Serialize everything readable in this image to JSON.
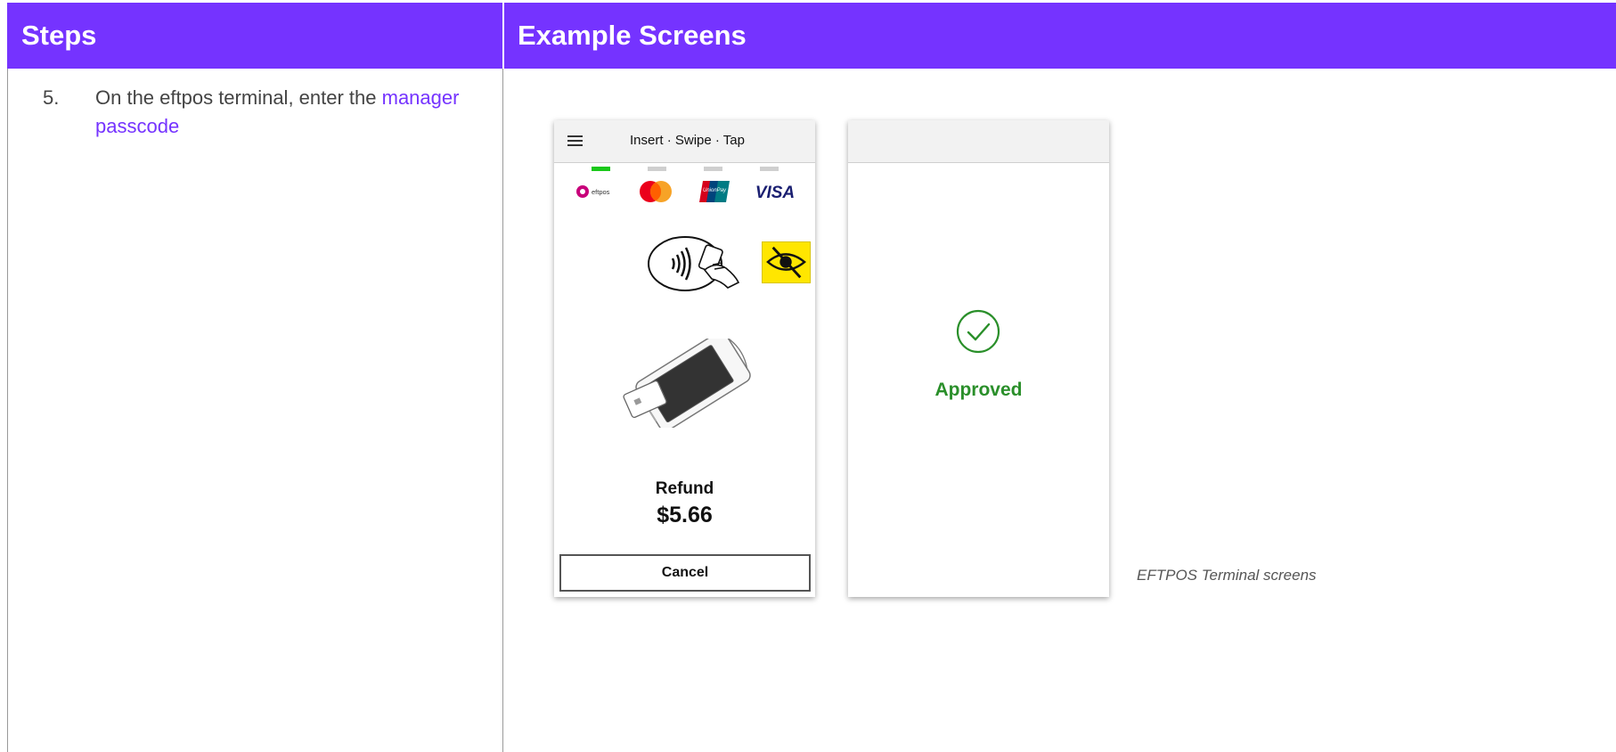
{
  "header": {
    "steps_label": "Steps",
    "examples_label": "Example Screens"
  },
  "step": {
    "number": "5.",
    "text_before": "On the eftpos terminal, enter the ",
    "link_text": "manager passcode"
  },
  "terminal_screen_1": {
    "title": "Insert · Swipe · Tap",
    "card_logos": [
      "eftpos-logo",
      "mastercard-logo",
      "unionpay-logo",
      "visa-logo"
    ],
    "visa_text": "VISA",
    "eftpos_text": "eftpos",
    "unionpay_text": "UnionPay",
    "transaction_type": "Refund",
    "amount": "$5.66",
    "cancel_label": "Cancel"
  },
  "terminal_screen_2": {
    "status": "Approved"
  },
  "caption": "EFTPOS Terminal screens",
  "colors": {
    "header_bg": "#7533ff",
    "link": "#7533ff",
    "approved": "#2a8f2a",
    "active_indicator": "#1ac81a"
  }
}
